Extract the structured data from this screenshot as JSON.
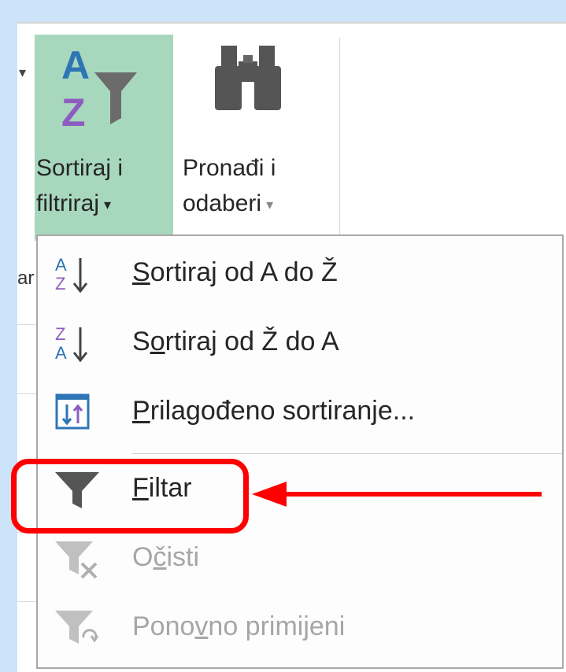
{
  "ribbon": {
    "sort_filter_label_line1": "Sortiraj i",
    "sort_filter_label_line2": "filtriraj",
    "find_select_label_line1": "Pronađi i",
    "find_select_label_line2": "odaberi",
    "dropdown_arrow": "▾",
    "truncated_left_text": "ar"
  },
  "menu": {
    "items": [
      {
        "label": "Sortiraj od A do Ž",
        "hotkey_char": "S",
        "icon": "sort-a-to-z-icon",
        "enabled": true
      },
      {
        "label": "Sortiraj od Ž do A",
        "hotkey_char": "o",
        "icon": "sort-z-to-a-icon",
        "enabled": true
      },
      {
        "label": "Prilagođeno sortiranje...",
        "hotkey_char": "P",
        "icon": "custom-sort-icon",
        "enabled": true
      },
      {
        "label": "Filtar",
        "hotkey_char": "F",
        "icon": "filter-icon",
        "enabled": true
      },
      {
        "label": "Očisti",
        "hotkey_char": "č",
        "icon": "clear-filter-icon",
        "enabled": false
      },
      {
        "label": "Ponovno primijeni",
        "hotkey_char": "v",
        "icon": "reapply-filter-icon",
        "enabled": false
      }
    ]
  },
  "colors": {
    "accent_selected": "#a7d7bd",
    "highlight": "#ff0000",
    "background": "#cce3f8"
  }
}
